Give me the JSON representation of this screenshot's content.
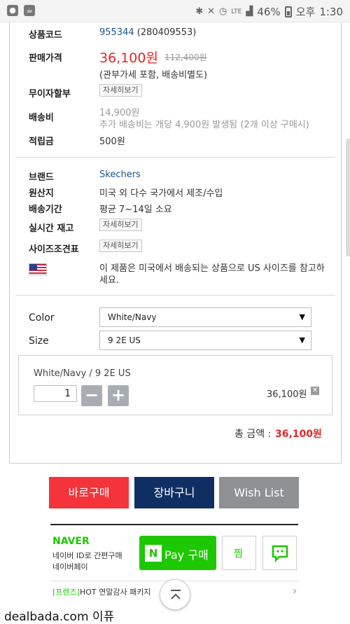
{
  "statusbar": {
    "battery": "46%",
    "period": "오후",
    "time": "1:30",
    "net": "LTE"
  },
  "product": {
    "code_label": "상품코드",
    "code": "955344",
    "code_sub": "(280409553)",
    "price_label": "판매가격",
    "price": "36,100원",
    "orig_price": "112,400원",
    "price_note": "(관부가세 포함, 배송비별도)",
    "installment_label": "무이자할부",
    "detail_btn": "자세히보기",
    "shipping_label": "배송비",
    "shipping": "14,900원",
    "shipping_note": "추가 배송비는 개당 4,900원 발생됨 (2개 이상 구매시)",
    "points_label": "적립금",
    "points": "500원"
  },
  "info": {
    "brand_label": "브랜드",
    "brand": "Skechers",
    "origin_label": "원산지",
    "origin": "미국 외 다수 국가에서 제조/수입",
    "delivery_label": "배송기간",
    "delivery": "평균 7~14일 소요",
    "stock_label": "실시간 재고",
    "size_chart_label": "사이즈조견표",
    "us_note_1": "이 제품은 미국에서 배송되는 상품으로 US 사이즈를 참고하",
    "us_note_2": "세요."
  },
  "options": {
    "color_label": "Color",
    "color_value": "White/Navy",
    "size_label": "Size",
    "size_value": "9 2E US",
    "selected": "White/Navy / 9 2E US",
    "quantity": "1",
    "line_price": "36,100원",
    "total_label": "총 금액 :",
    "total": "36,100원"
  },
  "buttons": {
    "buy_now": "바로구매",
    "cart": "장바구니",
    "wishlist": "Wish List"
  },
  "naver": {
    "brand": "NAVER",
    "line1": "네이버 ID로 간편구매",
    "line2": "네이버페이",
    "pay_n": "N",
    "pay_label": "Pay 구매",
    "zzim": "찜",
    "promo_tag": "[프렌즈]",
    "promo_text": "HOT 연말감사 패키지"
  },
  "watermark": {
    "site": "dealbada.com",
    "suffix": "이퓨"
  },
  "colors": {
    "buy_now": "#f4333a",
    "cart": "#0f2f63",
    "wishlist": "#8e9091",
    "price_red": "#e32626",
    "naver_green": "#1ec800"
  }
}
